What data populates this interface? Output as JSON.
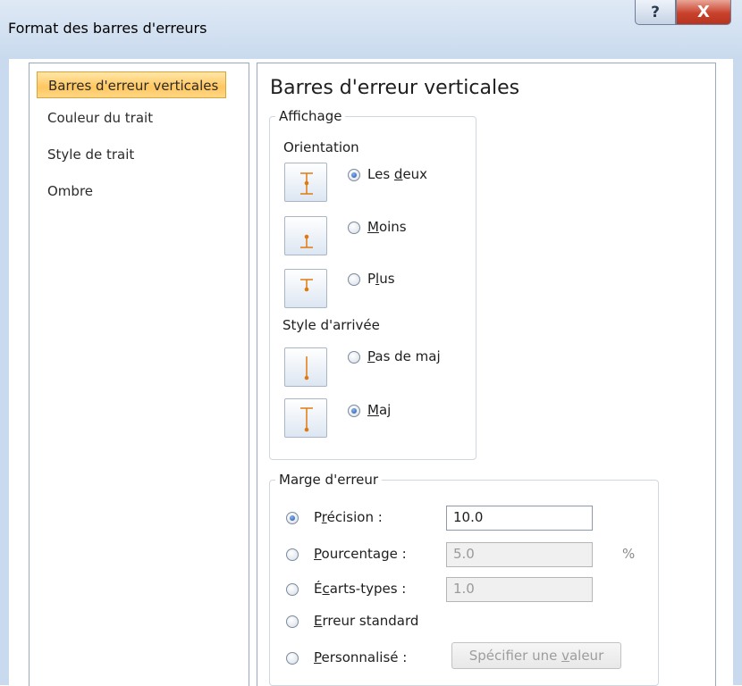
{
  "window": {
    "title": "Format des barres d'erreurs",
    "help_label": "?",
    "close_label": "X"
  },
  "sidebar": {
    "items": [
      {
        "label": "Barres d'erreur verticales",
        "selected": true
      },
      {
        "label": "Couleur du trait",
        "selected": false
      },
      {
        "label": "Style de trait",
        "selected": false
      },
      {
        "label": "Ombre",
        "selected": false
      }
    ]
  },
  "main": {
    "heading": "Barres d'erreur verticales",
    "display_group": {
      "legend": "Affichage",
      "orientation_label": "Orientation",
      "orientation_options": [
        {
          "pre": "Les ",
          "key": "d",
          "post": "eux",
          "checked": true,
          "icon": "error-bar-both-icon"
        },
        {
          "pre": "",
          "key": "M",
          "post": "oins",
          "checked": false,
          "icon": "error-bar-minus-icon"
        },
        {
          "pre": "P",
          "key": "l",
          "post": "us",
          "checked": false,
          "icon": "error-bar-plus-icon"
        }
      ],
      "end_style_label": "Style d'arrivée",
      "end_style_options": [
        {
          "pre": "",
          "key": "P",
          "post": "as de maj",
          "checked": false,
          "icon": "error-bar-no-cap-icon"
        },
        {
          "pre": "",
          "key": "M",
          "post": "aj",
          "checked": true,
          "icon": "error-bar-cap-icon"
        }
      ]
    },
    "margin_group": {
      "legend": "Marge d'erreur",
      "options": {
        "precision": {
          "pre": "P",
          "key": "r",
          "post": "écision :",
          "checked": true,
          "value": "10.0"
        },
        "percentage": {
          "pre": "",
          "key": "P",
          "post": "ourcentage :",
          "checked": false,
          "value": "5.0",
          "unit": "%"
        },
        "stddev": {
          "pre": "É",
          "key": "c",
          "post": "arts-types :",
          "checked": false,
          "value": "1.0"
        },
        "std_error": {
          "pre": "",
          "key": "E",
          "post": "rreur standard",
          "checked": false
        },
        "custom": {
          "pre": "",
          "key": "P",
          "post": "ersonnalisé :",
          "checked": false
        }
      },
      "specify_button": {
        "pre": "Spécifier une ",
        "key": "v",
        "post": "aleur"
      }
    }
  }
}
